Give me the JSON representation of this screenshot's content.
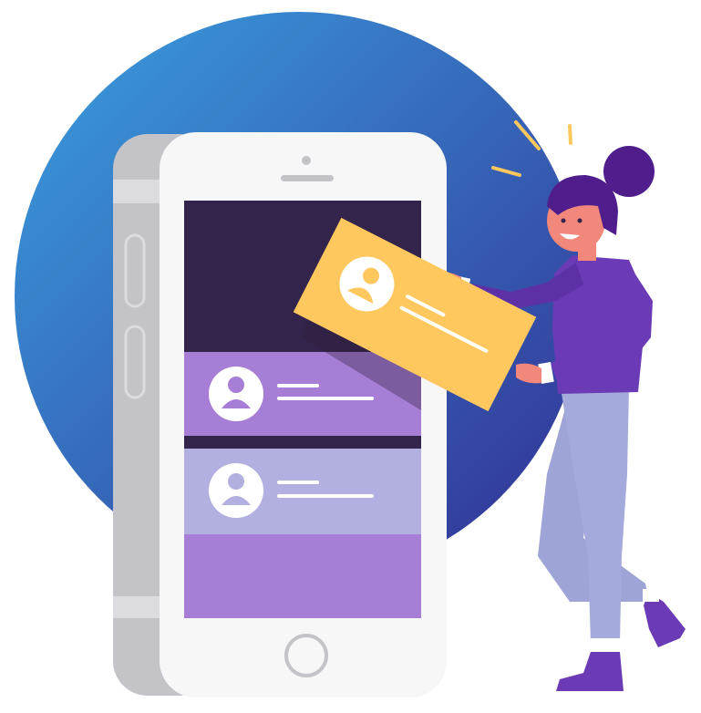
{
  "illustration": {
    "colors": {
      "background": "#ffffff",
      "circle_light": "#3aa0df",
      "circle_dark": "#322e92",
      "phone_body": "#f7f7f7",
      "phone_side": "#c4c3c8",
      "screen_dark": "#33244b",
      "card_purple": "#a77ed5",
      "card_lavender": "#b1b0e1",
      "card_yellow": "#fec85e",
      "avatar_circle": "#ffffff",
      "accent_lines": "#fec85e",
      "person_hair": "#4f1e8c",
      "person_skin": "#f2877b",
      "person_top": "#6b3bb6",
      "person_pants": "#a4aadb",
      "person_shoes": "#6b3bb6"
    },
    "icons": {
      "list_item_avatar": "user-avatar-icon",
      "card_avatar": "user-avatar-icon",
      "home_button": "home-button-icon",
      "speaker": "speaker-icon",
      "camera": "camera-icon"
    },
    "phone_list": {
      "visible_cards": 2,
      "dragged_card": "yellow"
    }
  }
}
